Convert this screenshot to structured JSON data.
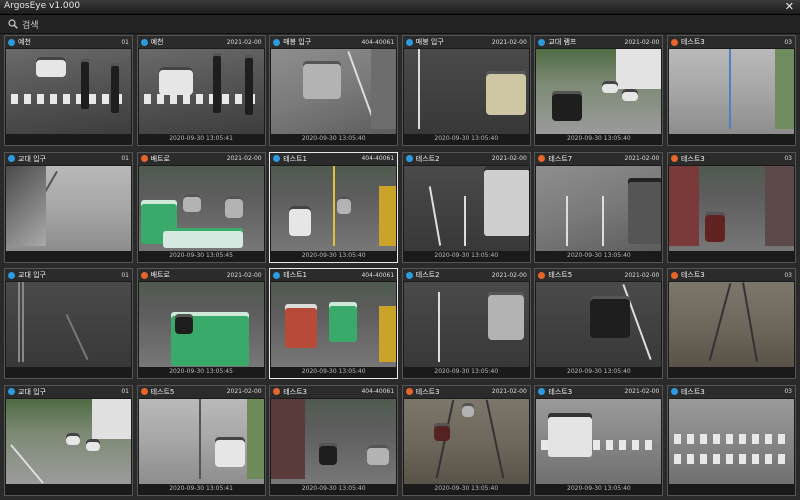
{
  "app": {
    "title": "ArgosEye v1.000",
    "close": "✕"
  },
  "toolbar": {
    "search_label": "검색"
  },
  "cameras": [
    {
      "name": "예천",
      "id": "01",
      "status": "blue",
      "ts": "",
      "selected": false
    },
    {
      "name": "예천",
      "id": "2021-02-00",
      "status": "blue",
      "ts": "2020-09-30 13:05:41",
      "selected": false
    },
    {
      "name": "매봉 입구",
      "id": "404-40061",
      "status": "blue",
      "ts": "2020-09-30 13:05:40",
      "selected": false
    },
    {
      "name": "매봉 입구",
      "id": "2021-02-00",
      "status": "blue",
      "ts": "2020-09-30 13:05:40",
      "selected": false
    },
    {
      "name": "교대 램프",
      "id": "2021-02-00",
      "status": "blue",
      "ts": "2020-09-30 13:05:40",
      "selected": false
    },
    {
      "name": "테스트3",
      "id": "03",
      "status": "orange",
      "ts": "",
      "selected": false
    },
    {
      "name": "교대 입구",
      "id": "01",
      "status": "blue",
      "ts": "",
      "selected": false
    },
    {
      "name": "배트로",
      "id": "2021-02-00",
      "status": "orange",
      "ts": "2020-09-30 13:05:45",
      "selected": false
    },
    {
      "name": "테스트1",
      "id": "404-40061",
      "status": "blue",
      "ts": "2020-09-30 13:05:40",
      "selected": true
    },
    {
      "name": "테스트2",
      "id": "2021-02-00",
      "status": "blue",
      "ts": "2020-09-30 13:05:40",
      "selected": false
    },
    {
      "name": "테스트7",
      "id": "2021-02-00",
      "status": "orange",
      "ts": "2020-09-30 13:05:40",
      "selected": false
    },
    {
      "name": "테스트3",
      "id": "03",
      "status": "orange",
      "ts": "",
      "selected": false
    },
    {
      "name": "교대 입구",
      "id": "01",
      "status": "blue",
      "ts": "",
      "selected": false
    },
    {
      "name": "배트로",
      "id": "2021-02-00",
      "status": "orange",
      "ts": "2020-09-30 13:05:45",
      "selected": false
    },
    {
      "name": "테스트1",
      "id": "404-40061",
      "status": "blue",
      "ts": "2020-09-30 13:05:40",
      "selected": true
    },
    {
      "name": "테스트2",
      "id": "2021-02-00",
      "status": "blue",
      "ts": "2020-09-30 13:05:40",
      "selected": false
    },
    {
      "name": "테스트5",
      "id": "2021-02-00",
      "status": "orange",
      "ts": "2020-09-30 13:05:40",
      "selected": false
    },
    {
      "name": "테스트3",
      "id": "03",
      "status": "orange",
      "ts": "",
      "selected": false
    },
    {
      "name": "교대 입구",
      "id": "01",
      "status": "blue",
      "ts": "",
      "selected": false
    },
    {
      "name": "테스트5",
      "id": "2021-02-00",
      "status": "orange",
      "ts": "2020-09-30 13:05:41",
      "selected": false
    },
    {
      "name": "테스트3",
      "id": "404-40061",
      "status": "orange",
      "ts": "2020-09-30 13:05:40",
      "selected": false
    },
    {
      "name": "테스트3",
      "id": "2021-02-00",
      "status": "orange",
      "ts": "2020-09-30 13:05:40",
      "selected": false
    },
    {
      "name": "테스트3",
      "id": "2021-02-00",
      "status": "blue",
      "ts": "2020-09-30 13:05:40",
      "selected": false
    },
    {
      "name": "테스트3",
      "id": "03",
      "status": "blue",
      "ts": "",
      "selected": false
    }
  ]
}
